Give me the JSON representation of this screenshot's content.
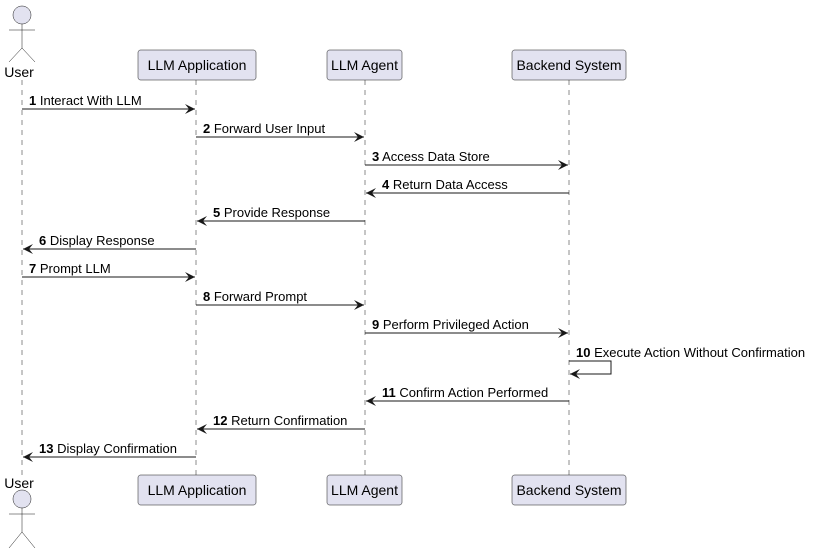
{
  "diagram": {
    "type": "sequence",
    "participants": [
      {
        "id": "user",
        "label": "User",
        "kind": "actor"
      },
      {
        "id": "app",
        "label": "LLM Application",
        "kind": "participant"
      },
      {
        "id": "agent",
        "label": "LLM Agent",
        "kind": "participant"
      },
      {
        "id": "backend",
        "label": "Backend System",
        "kind": "participant"
      }
    ],
    "messages": [
      {
        "num": "1",
        "text": "Interact With LLM",
        "from": "user",
        "to": "app"
      },
      {
        "num": "2",
        "text": "Forward User Input",
        "from": "app",
        "to": "agent"
      },
      {
        "num": "3",
        "text": "Access Data Store",
        "from": "agent",
        "to": "backend"
      },
      {
        "num": "4",
        "text": "Return Data Access",
        "from": "backend",
        "to": "agent"
      },
      {
        "num": "5",
        "text": "Provide Response",
        "from": "agent",
        "to": "app"
      },
      {
        "num": "6",
        "text": "Display Response",
        "from": "app",
        "to": "user"
      },
      {
        "num": "7",
        "text": "Prompt LLM",
        "from": "user",
        "to": "app"
      },
      {
        "num": "8",
        "text": "Forward Prompt",
        "from": "app",
        "to": "agent"
      },
      {
        "num": "9",
        "text": "Perform Privileged Action",
        "from": "agent",
        "to": "backend"
      },
      {
        "num": "10",
        "text": "Execute Action Without Confirmation",
        "from": "backend",
        "to": "backend"
      },
      {
        "num": "11",
        "text": "Confirm Action Performed",
        "from": "backend",
        "to": "agent"
      },
      {
        "num": "12",
        "text": "Return Confirmation",
        "from": "agent",
        "to": "app"
      },
      {
        "num": "13",
        "text": "Display Confirmation",
        "from": "app",
        "to": "user"
      }
    ]
  }
}
